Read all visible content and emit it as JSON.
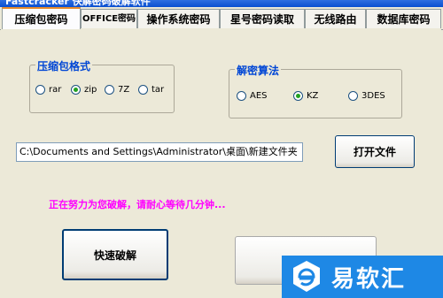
{
  "window": {
    "title": "Fastcracker 快解密码破解软件"
  },
  "tabs": [
    {
      "label": "压缩包密码",
      "active": true
    },
    {
      "label": "OFFICE密码",
      "active": false
    },
    {
      "label": "操作系统密码",
      "active": false
    },
    {
      "label": "星号密码读取",
      "active": false
    },
    {
      "label": "无线路由",
      "active": false
    },
    {
      "label": "数据库密码",
      "active": false
    }
  ],
  "archive_format": {
    "legend": "压缩包格式",
    "options": [
      {
        "label": "rar",
        "checked": false
      },
      {
        "label": "zip",
        "checked": true
      },
      {
        "label": "7Z",
        "checked": false
      },
      {
        "label": "tar",
        "checked": false
      }
    ]
  },
  "algorithm": {
    "legend": "解密算法",
    "options": [
      {
        "label": "AES",
        "checked": false
      },
      {
        "label": "KZ",
        "checked": true
      },
      {
        "label": "3DES",
        "checked": false
      }
    ]
  },
  "path": {
    "value": "C:\\Documents and Settings\\Administrator\\桌面\\新建文件夹"
  },
  "buttons": {
    "open_file": "打开文件",
    "quick_crack": "快速破解"
  },
  "status": {
    "text": "正在努力为您破解，请耐心等待几分钟..."
  },
  "watermark": {
    "text": "易软汇"
  },
  "colors": {
    "legend": "#0046d5",
    "status": "#ff00ff",
    "watermark_bg": "#1e88e5"
  }
}
